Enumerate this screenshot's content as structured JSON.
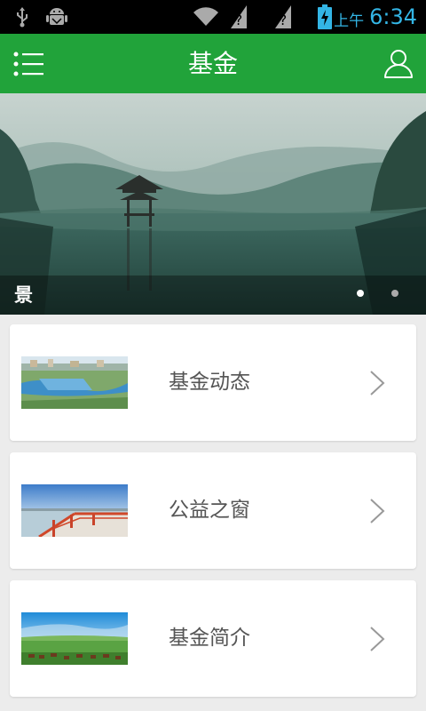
{
  "status_bar": {
    "ampm": "上午",
    "time": "6:34"
  },
  "header": {
    "title": "基金",
    "menu_icon": "list-menu-icon",
    "user_icon": "user-profile-icon",
    "background_color": "#21a33a"
  },
  "banner": {
    "caption": "景",
    "slide_count": 2,
    "active_slide_number": 1
  },
  "list": {
    "items": [
      {
        "label": "基金动态",
        "thumbnail": "river-city-aerial-thumbnail"
      },
      {
        "label": "公益之窗",
        "thumbnail": "lakeside-pavilion-thumbnail"
      },
      {
        "label": "基金简介",
        "thumbnail": "grassland-horses-thumbnail"
      }
    ]
  }
}
